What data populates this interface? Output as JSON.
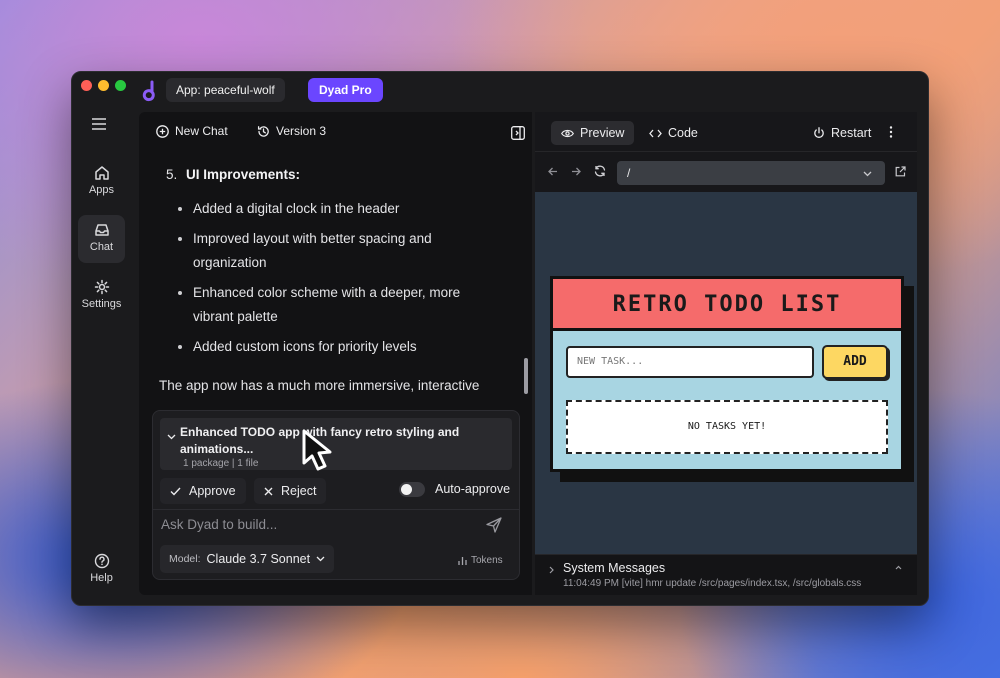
{
  "titlebar": {
    "app_label": "App: peaceful-wolf",
    "pro_label": "Dyad Pro"
  },
  "sidebar": {
    "items": [
      {
        "label": "Apps",
        "icon": "home-icon"
      },
      {
        "label": "Chat",
        "icon": "inbox-icon",
        "active": true
      },
      {
        "label": "Settings",
        "icon": "gear-icon"
      },
      {
        "label": "Help",
        "icon": "help-icon"
      }
    ]
  },
  "chat": {
    "new_chat_label": "New Chat",
    "version_label": "Version 3",
    "message": {
      "item_number": "5.",
      "heading": "UI Improvements:",
      "bullets": [
        "Added a digital clock in the header",
        "Improved layout with better spacing and organization",
        "Enhanced color scheme with a deeper, more vibrant palette",
        "Added custom icons for priority levels"
      ],
      "tail": "The app now has a much more immersive, interactive"
    },
    "proposal": {
      "title": "Enhanced TODO app with fancy retro styling and animations...",
      "meta": "1 package | 1 file"
    },
    "approve_label": "Approve",
    "reject_label": "Reject",
    "auto_approve_label": "Auto-approve",
    "auto_approve_on": false,
    "prompt_placeholder": "Ask Dyad to build...",
    "model_prefix": "Model:",
    "model_name": "Claude 3.7 Sonnet",
    "tokens_label": "Tokens"
  },
  "preview": {
    "preview_tab": "Preview",
    "code_tab": "Code",
    "restart_label": "Restart",
    "url": "/",
    "app": {
      "title": "RETRO TODO LIST",
      "input_placeholder": "NEW TASK...",
      "add_label": "ADD",
      "empty_label": "NO TASKS YET!"
    },
    "system": {
      "title": "System Messages",
      "line": "11:04:49 PM [vite] hmr update /src/pages/index.tsx, /src/globals.css"
    }
  },
  "colors": {
    "accent": "#6b46ff",
    "retro_header": "#f56b6b",
    "retro_body": "#a8d5e2",
    "retro_button": "#fdd762"
  }
}
